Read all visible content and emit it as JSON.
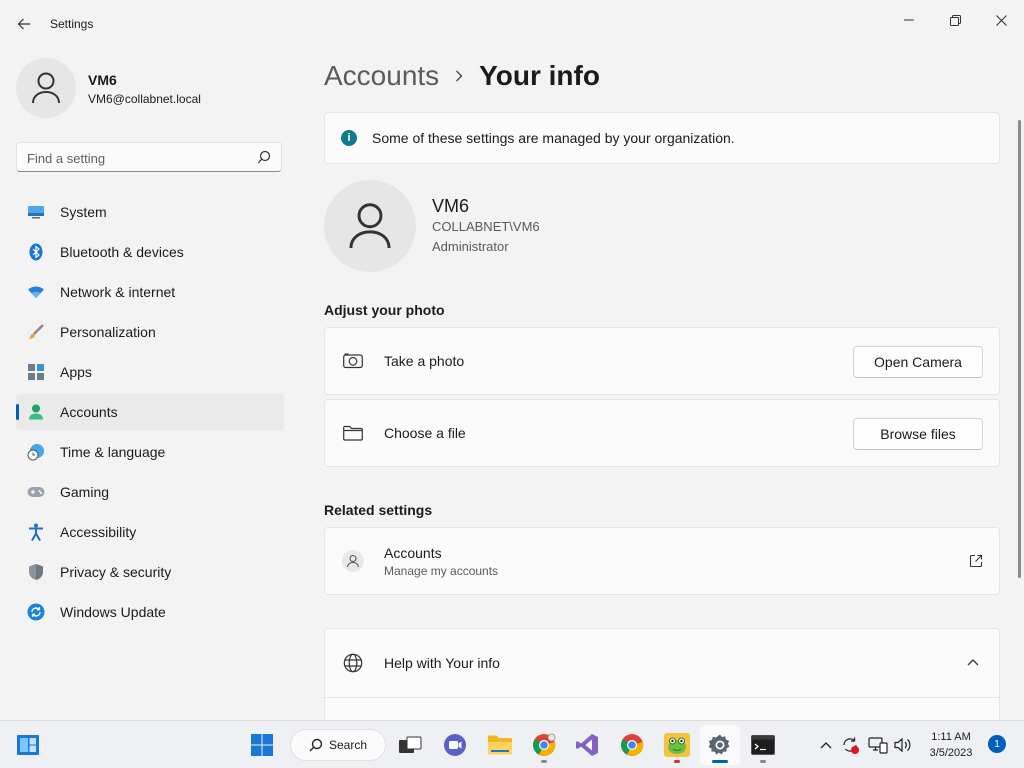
{
  "window": {
    "title": "Settings"
  },
  "profile": {
    "name": "VM6",
    "email": "VM6@collabnet.local"
  },
  "search": {
    "placeholder": "Find a setting"
  },
  "nav": {
    "items": [
      {
        "label": "System",
        "icon": "monitor-icon"
      },
      {
        "label": "Bluetooth & devices",
        "icon": "bluetooth-icon"
      },
      {
        "label": "Network & internet",
        "icon": "wifi-icon"
      },
      {
        "label": "Personalization",
        "icon": "brush-icon"
      },
      {
        "label": "Apps",
        "icon": "apps-icon"
      },
      {
        "label": "Accounts",
        "icon": "person-icon",
        "active": true
      },
      {
        "label": "Time & language",
        "icon": "globe-clock-icon"
      },
      {
        "label": "Gaming",
        "icon": "gamepad-icon"
      },
      {
        "label": "Accessibility",
        "icon": "accessibility-icon"
      },
      {
        "label": "Privacy & security",
        "icon": "shield-icon"
      },
      {
        "label": "Windows Update",
        "icon": "update-icon"
      }
    ]
  },
  "breadcrumb": {
    "parent": "Accounts",
    "current": "Your info"
  },
  "banner": {
    "text": "Some of these settings are managed by your organization."
  },
  "user": {
    "name": "VM6",
    "domain": "COLLABNET\\VM6",
    "role": "Administrator"
  },
  "photo": {
    "heading": "Adjust your photo",
    "take_label": "Take a photo",
    "camera_button": "Open Camera",
    "file_label": "Choose a file",
    "browse_button": "Browse files"
  },
  "related": {
    "heading": "Related settings",
    "accounts_title": "Accounts",
    "accounts_sub": "Manage my accounts"
  },
  "help": {
    "title": "Help with Your info"
  },
  "taskbar": {
    "search_label": "Search",
    "time": "1:11 AM",
    "date": "3/5/2023",
    "notification_count": "1"
  },
  "colors": {
    "accent": "#005fb8",
    "info": "#0f7b8c",
    "background": "#f3f3f3",
    "card": "#fbfbfb"
  }
}
